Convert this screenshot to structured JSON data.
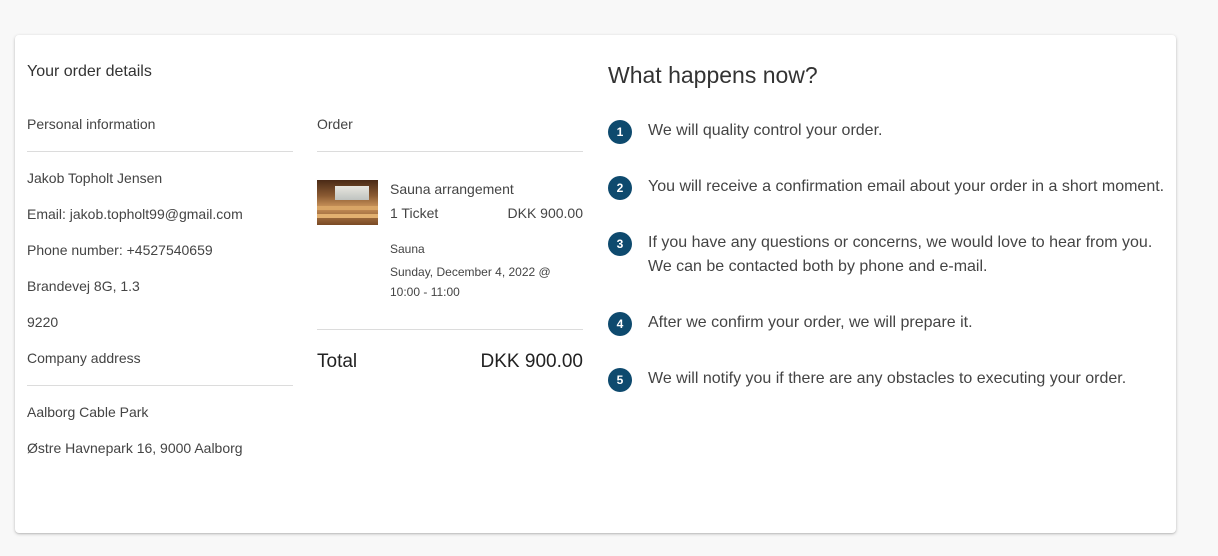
{
  "order_details": {
    "title": "Your order details",
    "personal": {
      "header": "Personal information",
      "name": "Jakob Topholt Jensen",
      "email": "Email: jakob.topholt99@gmail.com",
      "phone": "Phone number: +4527540659",
      "street": "Brandevej 8G, 1.3",
      "postal": "9220"
    },
    "company": {
      "header": "Company address",
      "name": "Aalborg Cable Park",
      "address": "Østre Havnepark 16, 9000 Aalborg"
    }
  },
  "order": {
    "header": "Order",
    "item": {
      "name": "Sauna arrangement",
      "quantity": "1 Ticket",
      "price": "DKK 900.00",
      "category": "Sauna",
      "date": "Sunday, December 4, 2022 @ 10:00 - 11:00"
    },
    "total_label": "Total",
    "total_value": "DKK 900.00"
  },
  "what_happens": {
    "title": "What happens now?",
    "steps": [
      {
        "number": "1",
        "text": "We will quality control your order."
      },
      {
        "number": "2",
        "text": "You will receive a confirmation email about your order in a short moment."
      },
      {
        "number": "3",
        "text": "If you have any questions or concerns, we would love to hear from you. We can be contacted both by phone and e-mail."
      },
      {
        "number": "4",
        "text": "After we confirm your order, we will prepare it."
      },
      {
        "number": "5",
        "text": "We will notify you if there are any obstacles to executing your order."
      }
    ]
  },
  "colors": {
    "step_badge": "#0e4a6e",
    "page_background": "#f8f8f8",
    "card_background": "#ffffff"
  }
}
